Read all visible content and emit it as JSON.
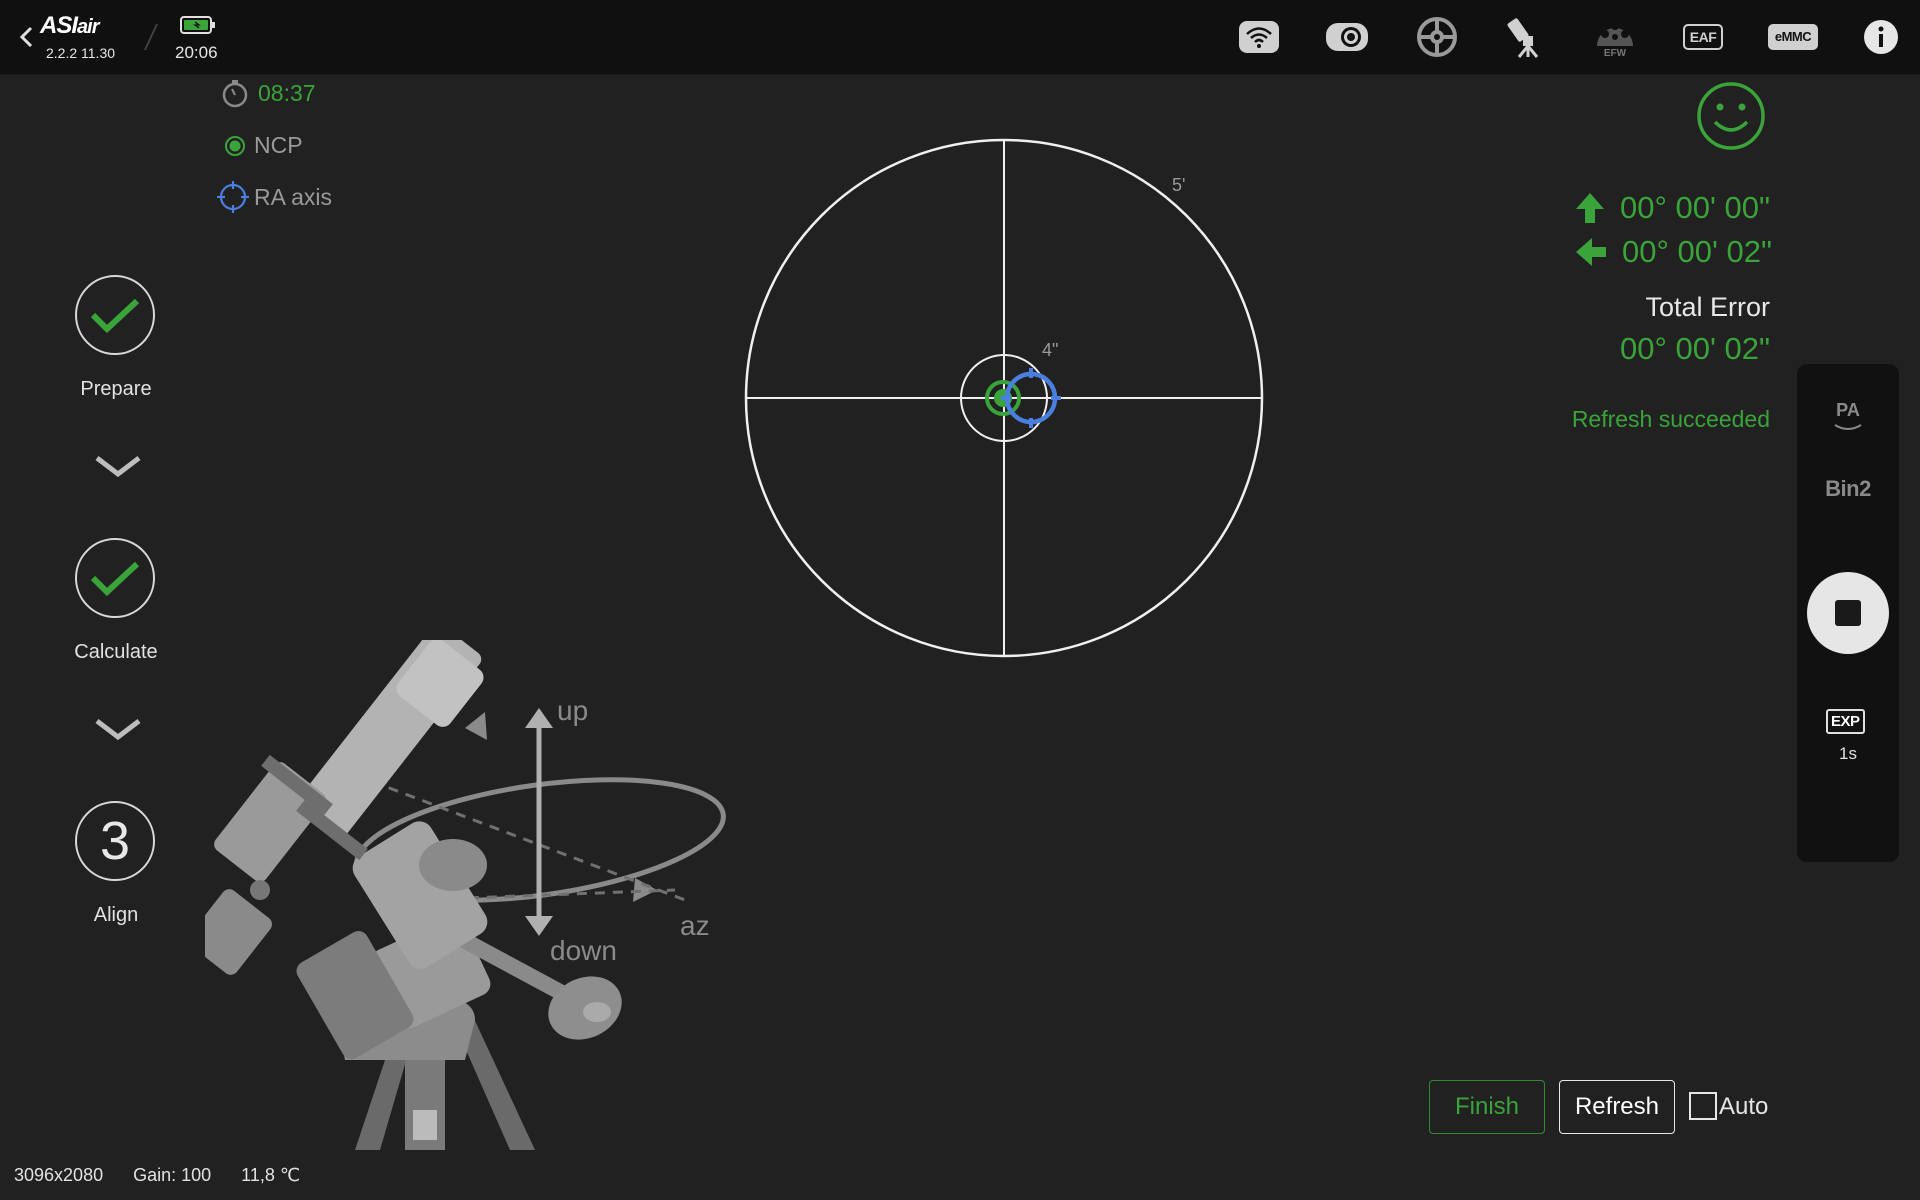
{
  "app": {
    "logo_main": "ASI",
    "logo_sub": "air",
    "version": "2.2.2 11.30",
    "clock": "20:06"
  },
  "toolbar": {
    "icons": [
      "wifi-icon",
      "camera-icon",
      "guide-scope-icon",
      "telescope-mount-icon",
      "filter-wheel-icon",
      "focuser-icon",
      "storage-icon",
      "info-icon"
    ],
    "efw_label": "EFW",
    "eaf_label": "EAF",
    "emmc_label": "eMMC"
  },
  "status": {
    "elapsed": "08:37",
    "ncp_label": "NCP",
    "ra_axis_label": "RA axis"
  },
  "steps": [
    {
      "label": "Prepare",
      "state": "done"
    },
    {
      "label": "Calculate",
      "state": "done"
    },
    {
      "label": "Align",
      "state": "current",
      "number": "3"
    }
  ],
  "target": {
    "outer_ring_label": "5'",
    "inner_ring_label": "4\""
  },
  "mount_diagram": {
    "up_label": "up",
    "down_label": "down",
    "az_label": "az"
  },
  "error": {
    "altitude": "00° 00' 00\"",
    "azimuth": "00° 00' 02\"",
    "total_label": "Total Error",
    "total": "00° 00' 02\"",
    "message": "Refresh succeeded"
  },
  "side_panel": {
    "pa_label": "PA",
    "bin_label": "Bin2",
    "exp_label": "EXP",
    "exp_value": "1s"
  },
  "actions": {
    "finish_label": "Finish",
    "refresh_label": "Refresh",
    "auto_label": "Auto",
    "auto_checked": false
  },
  "footer": {
    "resolution": "3096x2080",
    "gain": "Gain: 100",
    "temperature": "11,8 ℃"
  },
  "colors": {
    "accent_green": "#3aa33a",
    "ra_blue": "#4a7fe0",
    "background": "#212121"
  }
}
